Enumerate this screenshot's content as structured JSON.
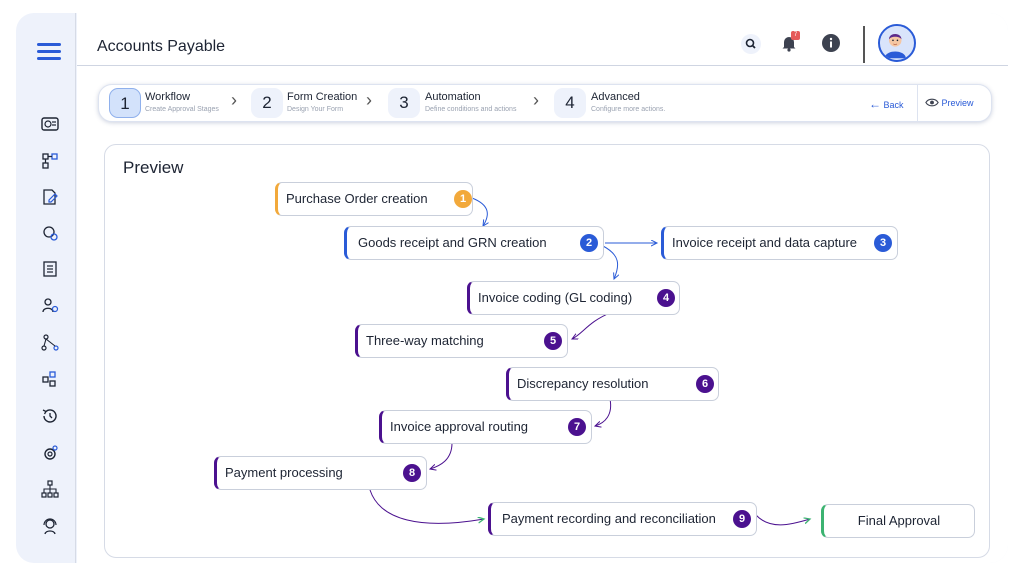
{
  "header": {
    "title": "Accounts Payable",
    "notification_count": "7"
  },
  "sidebar": {
    "items": [
      {
        "icon": "dashboard-icon"
      },
      {
        "icon": "workflow-icon"
      },
      {
        "icon": "edit-form-icon"
      },
      {
        "icon": "settings-gear-icon"
      },
      {
        "icon": "document-list-icon"
      },
      {
        "icon": "user-settings-icon"
      },
      {
        "icon": "network-icon"
      },
      {
        "icon": "integration-icon"
      },
      {
        "icon": "history-icon"
      },
      {
        "icon": "automation-icon"
      },
      {
        "icon": "org-chart-icon"
      },
      {
        "icon": "support-agent-icon"
      }
    ]
  },
  "stepper": {
    "steps": [
      {
        "num": "1",
        "title": "Workflow",
        "subtitle": "Create Approval Stages"
      },
      {
        "num": "2",
        "title": "Form Creation",
        "subtitle": "Design Your Form"
      },
      {
        "num": "3",
        "title": "Automation",
        "subtitle": "Define conditions and actions"
      },
      {
        "num": "4",
        "title": "Advanced",
        "subtitle": "Configure more actions."
      }
    ],
    "back_label": "Back",
    "preview_label": "Preview"
  },
  "preview": {
    "title": "Preview",
    "nodes": [
      {
        "label": "Purchase Order creation",
        "num": "1"
      },
      {
        "label": "Goods receipt and GRN creation",
        "num": "2"
      },
      {
        "label": "Invoice receipt and data capture",
        "num": "3"
      },
      {
        "label": "Invoice coding (GL coding)",
        "num": "4"
      },
      {
        "label": "Three-way matching",
        "num": "5"
      },
      {
        "label": "Discrepancy resolution",
        "num": "6"
      },
      {
        "label": "Invoice approval routing",
        "num": "7"
      },
      {
        "label": "Payment processing",
        "num": "8"
      },
      {
        "label": "Payment recording and reconciliation",
        "num": "9"
      },
      {
        "label": "Final Approval"
      }
    ]
  },
  "colors": {
    "accent": "#2a5bd7",
    "start": "#f2a93b",
    "purple": "#4b118f",
    "end": "#3cb371"
  }
}
